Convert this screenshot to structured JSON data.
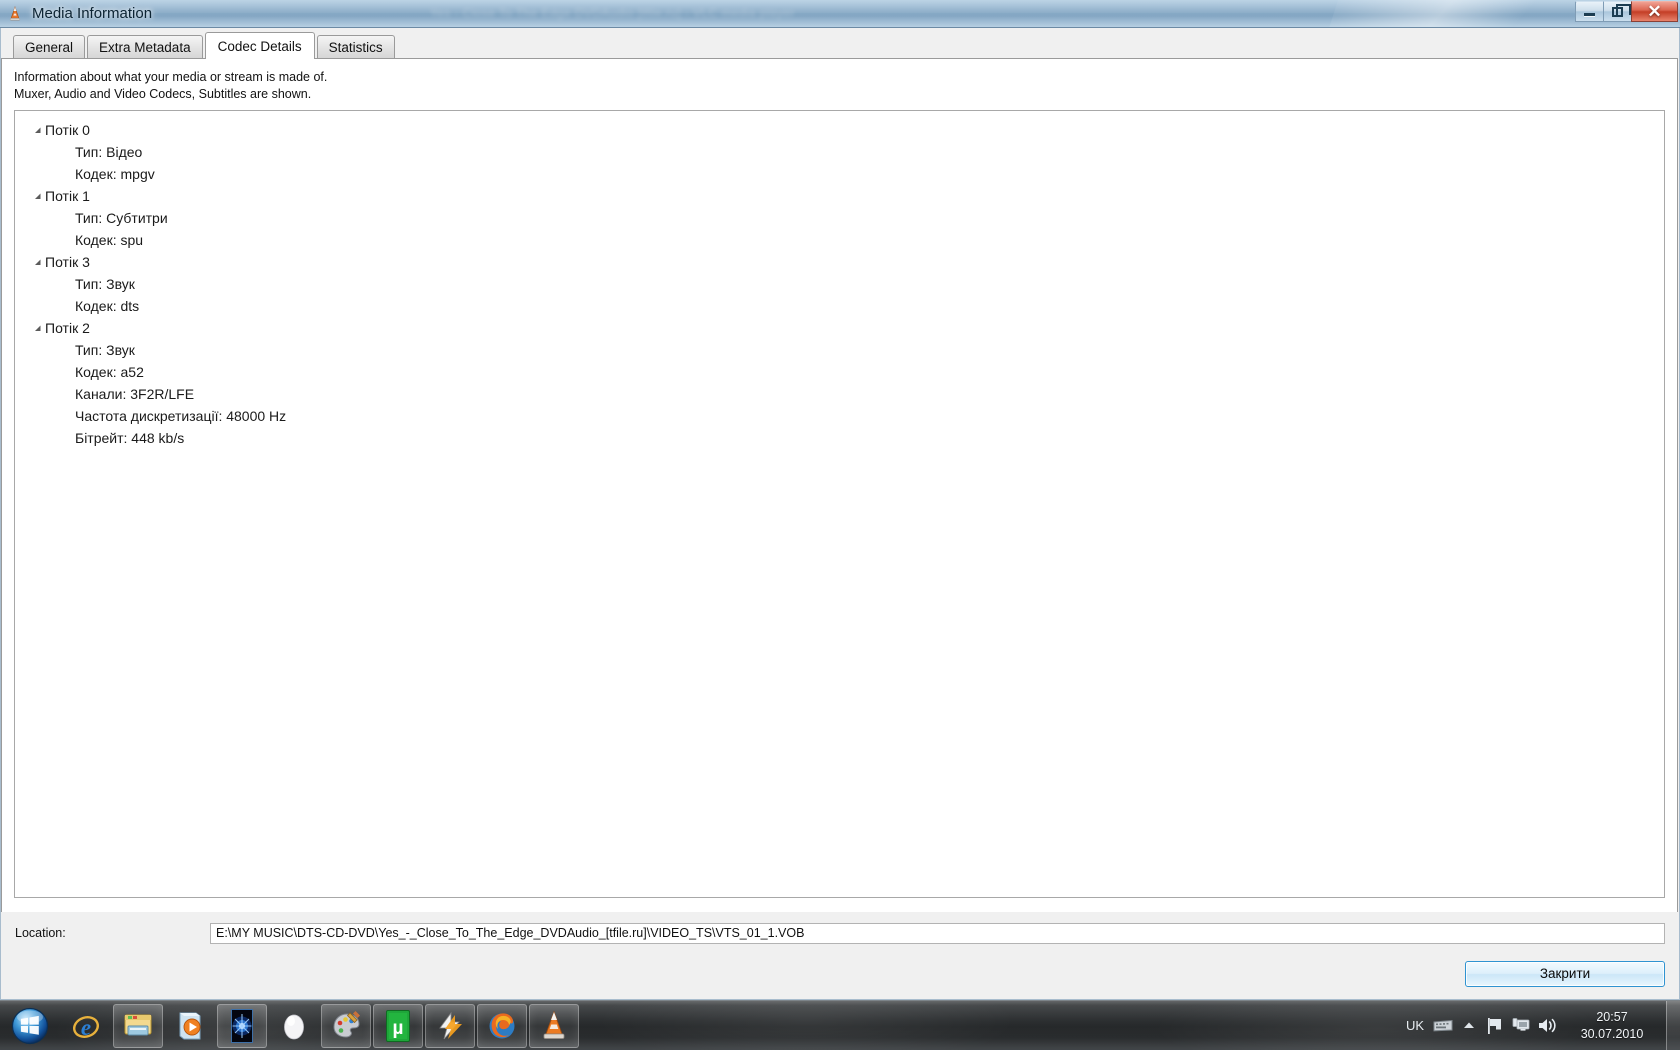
{
  "window": {
    "title": "Media Information",
    "app_icon": "vlc-cone-icon",
    "glass_ghost_text": "Yes  -  Close To The Edge DVDAudio [tfile.ru] - VLC media player",
    "controls": {
      "minimize": "minimize-button",
      "restore": "restore-button",
      "close": "close-button",
      "close_glyph": "✕"
    }
  },
  "tabs": [
    {
      "label": "General",
      "active": false
    },
    {
      "label": "Extra Metadata",
      "active": false
    },
    {
      "label": "Codec Details",
      "active": true
    },
    {
      "label": "Statistics",
      "active": false
    }
  ],
  "description": {
    "line1": "Information about what your media or stream is made of.",
    "line2": "Muxer, Audio and Video Codecs, Subtitles are shown."
  },
  "tree": [
    {
      "level": 0,
      "label": "Потік 0",
      "expanded": true
    },
    {
      "level": 1,
      "label": "Тип: Відео"
    },
    {
      "level": 1,
      "label": "Кодек: mpgv"
    },
    {
      "level": 0,
      "label": "Потік 1",
      "expanded": true
    },
    {
      "level": 1,
      "label": "Тип: Субтитри"
    },
    {
      "level": 1,
      "label": "Кодек: spu"
    },
    {
      "level": 0,
      "label": "Потік 3",
      "expanded": true
    },
    {
      "level": 1,
      "label": "Тип: Звук"
    },
    {
      "level": 1,
      "label": "Кодек: dts"
    },
    {
      "level": 0,
      "label": "Потік 2",
      "expanded": true
    },
    {
      "level": 1,
      "label": "Тип: Звук"
    },
    {
      "level": 1,
      "label": "Кодек: a52"
    },
    {
      "level": 1,
      "label": "Канали: 3F2R/LFE"
    },
    {
      "level": 1,
      "label": "Частота дискретизації: 48000 Hz"
    },
    {
      "level": 1,
      "label": "Бітрейт: 448 kb/s"
    }
  ],
  "location": {
    "label": "Location:",
    "value": "E:\\MY MUSIC\\DTS-CD-DVD\\Yes_-_Close_To_The_Edge_DVDAudio_[tfile.ru]\\VIDEO_TS\\VTS_01_1.VOB"
  },
  "buttons": {
    "close": "Закрити"
  },
  "taskbar": {
    "start": "start-orb-icon",
    "items": [
      {
        "name": "internet-explorer-icon",
        "pinned": false
      },
      {
        "name": "windows-explorer-icon",
        "pinned": true
      },
      {
        "name": "windows-media-player-icon",
        "pinned": false
      },
      {
        "name": "blue-burst-app-icon",
        "pinned": true
      },
      {
        "name": "white-egg-app-icon",
        "pinned": false
      },
      {
        "name": "paint-icon",
        "pinned": true
      },
      {
        "name": "utorrent-icon",
        "pinned": true
      },
      {
        "name": "winamp-icon",
        "pinned": true
      },
      {
        "name": "firefox-icon",
        "pinned": true
      },
      {
        "name": "vlc-media-player-icon",
        "pinned": true
      }
    ],
    "tray": {
      "language": "UK",
      "icons": [
        "keyboard-icon",
        "show-hidden-icons-chevron",
        "action-center-flag-icon",
        "network-icon",
        "volume-icon"
      ],
      "time": "20:57",
      "date": "30.07.2010"
    }
  },
  "colors": {
    "accent_blue": "#2f93d1",
    "titlebar_blue": "#86a9c6",
    "close_red": "#c33e26",
    "tab_active_bg": "#ffffff",
    "window_bg": "#f0f0f0"
  }
}
